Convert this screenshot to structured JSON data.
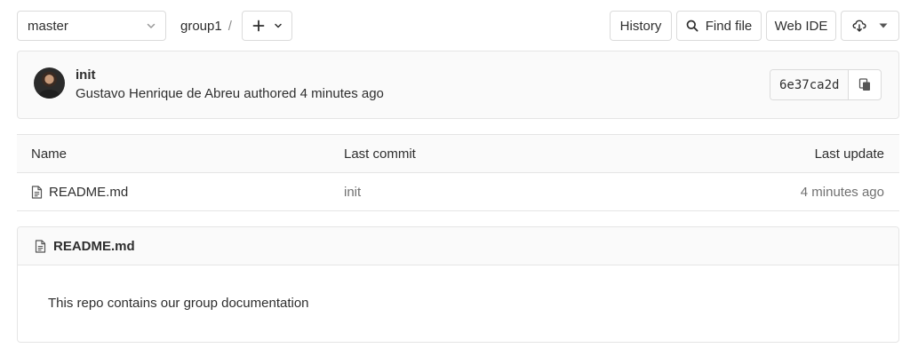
{
  "toolbar": {
    "branch": "master",
    "breadcrumb": "group1",
    "breadcrumb_sep": "/",
    "history_label": "History",
    "find_file_label": "Find file",
    "web_ide_label": "Web IDE"
  },
  "commit": {
    "title": "init",
    "author_line": "Gustavo Henrique de Abreu authored 4 minutes ago",
    "sha": "6e37ca2d"
  },
  "tree": {
    "columns": [
      "Name",
      "Last commit",
      "Last update"
    ],
    "rows": [
      {
        "name": "README.md",
        "last_commit": "init",
        "last_update": "4 minutes ago"
      }
    ]
  },
  "readme": {
    "filename": "README.md",
    "content": "This repo contains our group documentation"
  },
  "colors": {
    "border": "#e5e5e5",
    "header_bg": "#fafafa",
    "muted_text": "#707070"
  },
  "icons": [
    "chevron-down-icon",
    "plus-icon",
    "search-icon",
    "download-icon",
    "copy-icon",
    "file-icon"
  ]
}
